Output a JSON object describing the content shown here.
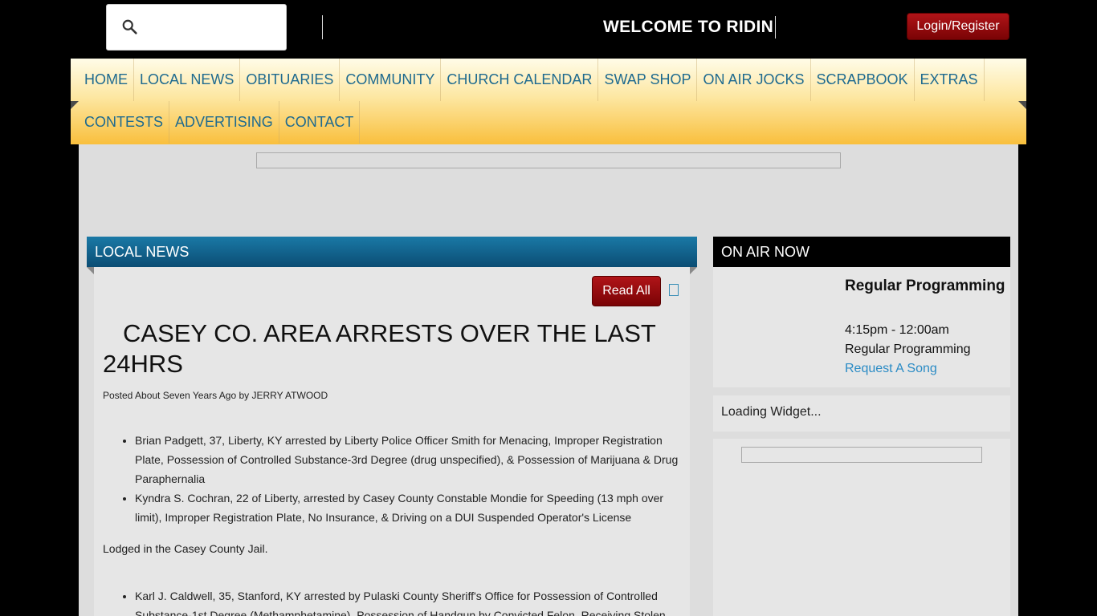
{
  "header": {
    "search_placeholder": "",
    "marquee_text": "WELCOME TO RIDIN",
    "login_label": "Login/Register"
  },
  "nav": {
    "row1": [
      "HOME",
      "LOCAL NEWS",
      "OBITUARIES",
      "COMMUNITY",
      "CHURCH CALENDAR",
      "SWAP SHOP",
      "ON AIR JOCKS",
      "SCRAPBOOK",
      "EXTRAS"
    ],
    "row2": [
      "CONTESTS",
      "ADVERTISING",
      "CONTACT"
    ]
  },
  "local_news": {
    "heading": "LOCAL NEWS",
    "read_all_label": "Read All",
    "article_title": "CASEY CO. AREA ARRESTS OVER THE LAST 24HRS",
    "posted": "Posted About Seven Years Ago by JERRY ATWOOD",
    "bullets_1": [
      "Brian Padgett, 37, Liberty, KY arrested by Liberty Police Officer Smith for Menacing, Improper Registration Plate, Possession of Controlled Substance-3rd Degree (drug unspecified), & Possession of Marijuana & Drug Paraphernalia",
      "Kyndra S. Cochran, 22 of Liberty, arrested by Casey County Constable Mondie for Speeding (13 mph over limit), Improper Registration Plate, No Insurance, & Driving on a DUI Suspended Operator's License"
    ],
    "lodged": "Lodged in the Casey County Jail.",
    "bullets_2": [
      "Karl J. Caldwell, 35, Stanford, KY arrested by Pulaski County Sheriff's Office for Possession of Controlled Substance-1st Degree (Methamphetamine), Possession of Handgun by Convicted Felon, Receiving Stolen"
    ]
  },
  "on_air": {
    "heading": "ON AIR NOW",
    "show_title": "Regular Programming",
    "show_time": "4:15pm - 12:00am",
    "show_name": "Regular Programming",
    "request_label": "Request A Song",
    "widget_text": "Loading Widget..."
  }
}
